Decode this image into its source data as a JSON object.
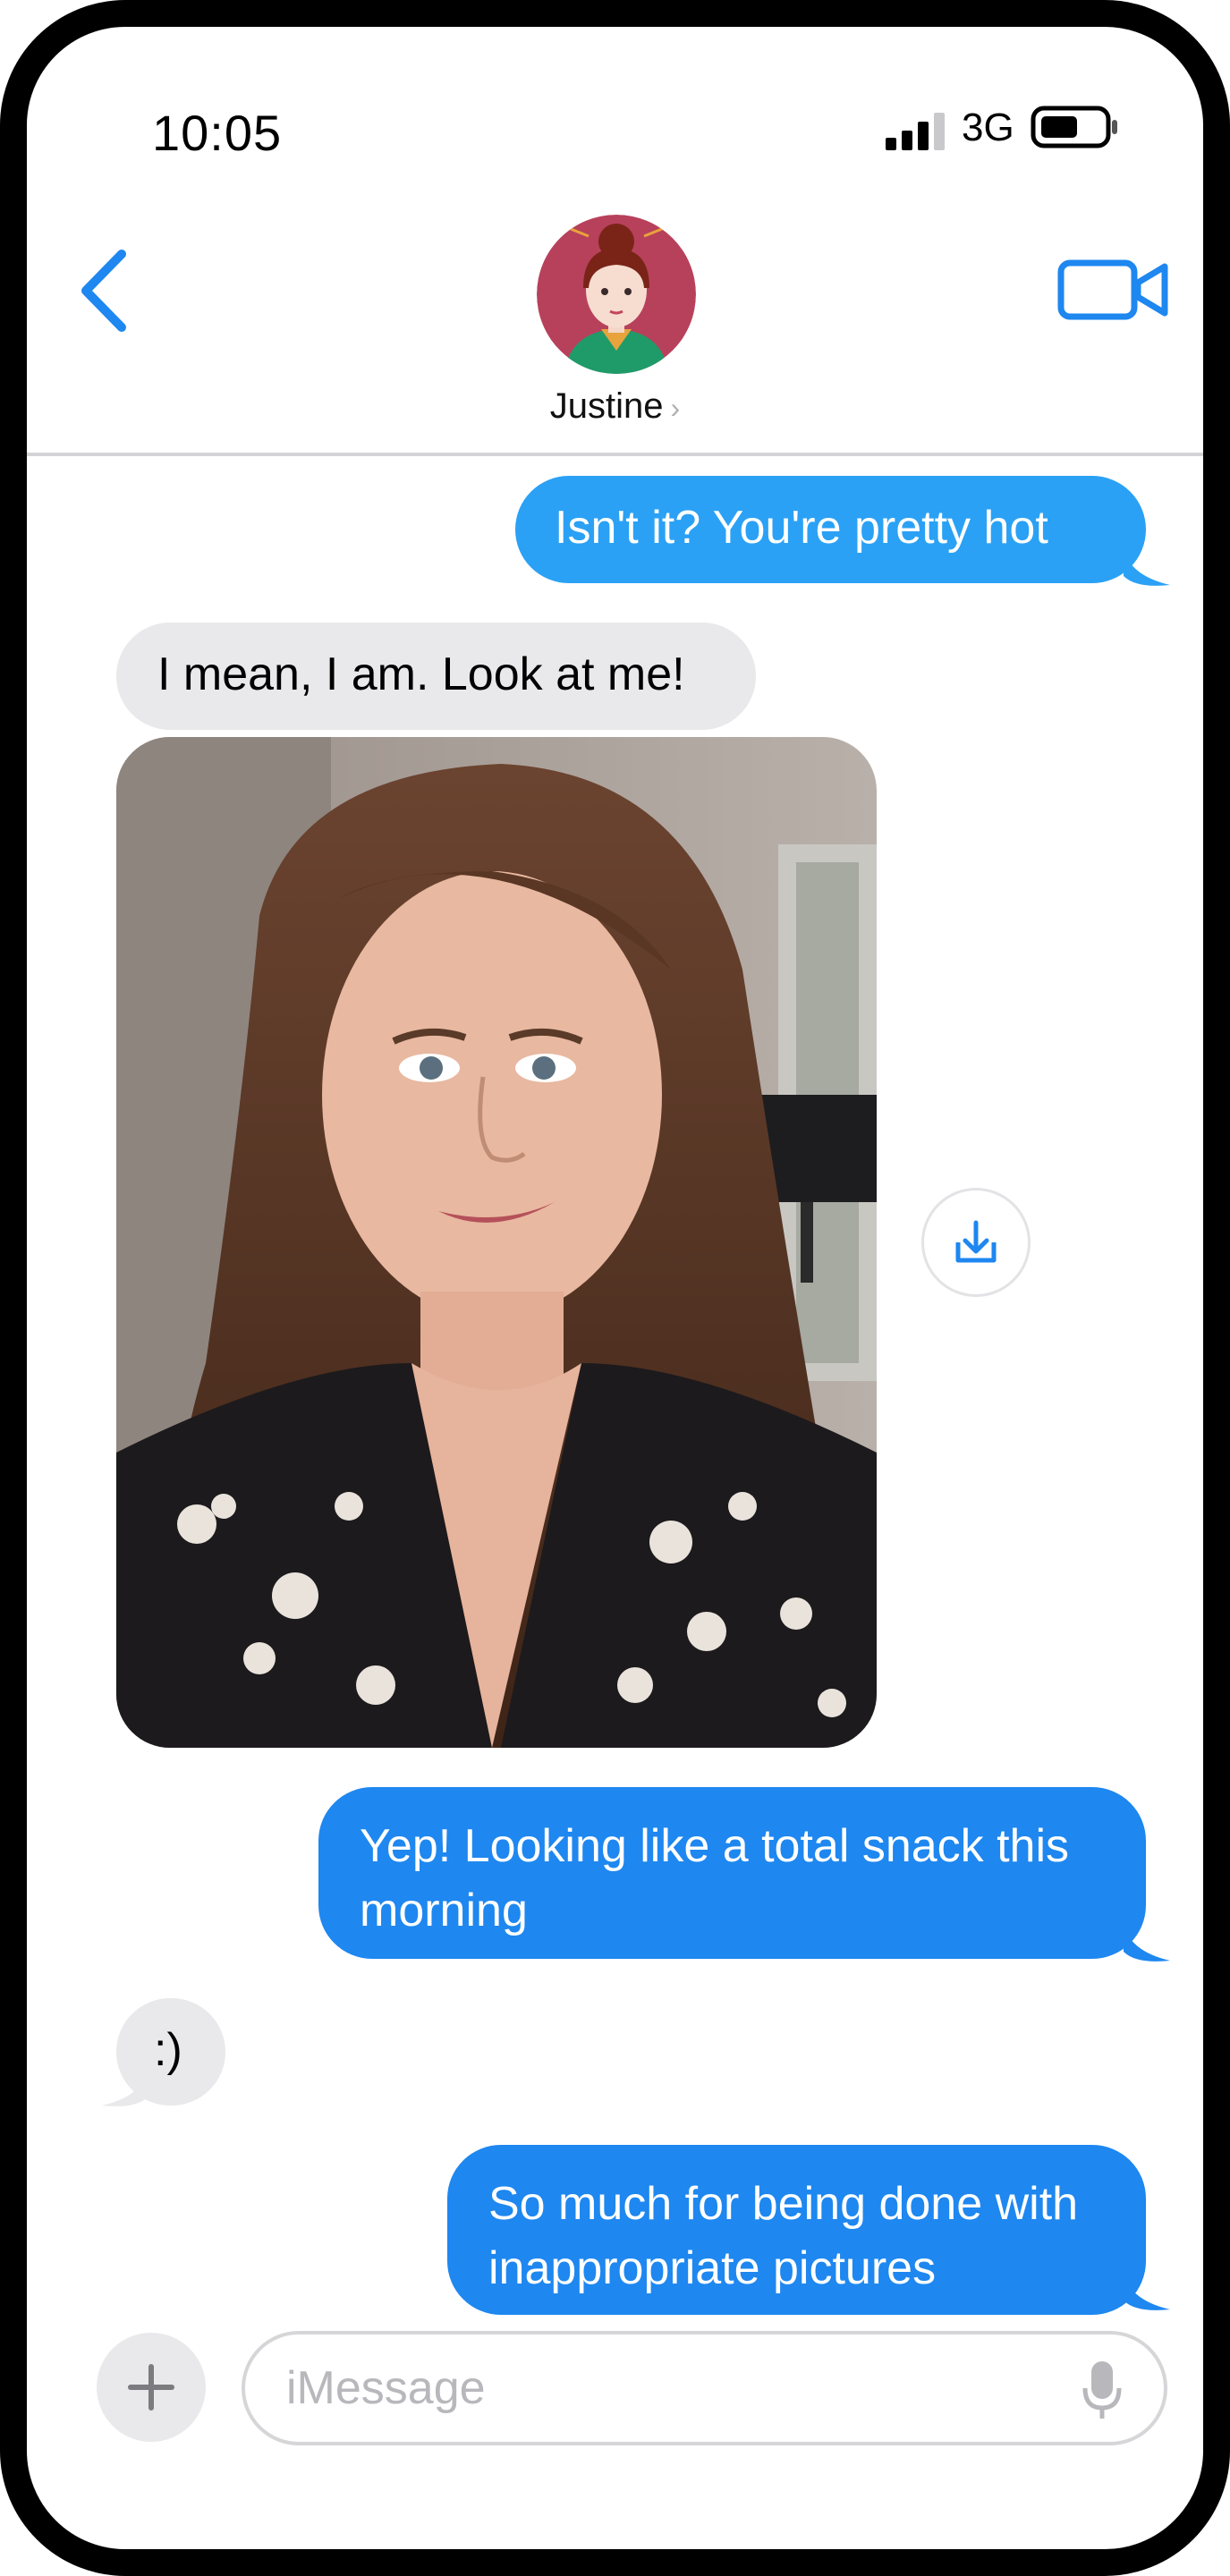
{
  "status_bar": {
    "time": "10:05",
    "network": "3G"
  },
  "header": {
    "contact_name": "Justine",
    "chevron": "›",
    "icons": {
      "back": "chevron-left-icon",
      "video": "video-camera-icon"
    }
  },
  "messages": [
    {
      "direction": "outgoing",
      "text": "Isn't it?  You're pretty hot"
    },
    {
      "direction": "incoming",
      "text": "I mean, I am.  Look at me!"
    },
    {
      "direction": "incoming",
      "type": "photo"
    },
    {
      "direction": "outgoing",
      "lines": [
        "Yep!  Looking like a total snack this",
        "morning"
      ]
    },
    {
      "direction": "incoming",
      "text": ":)"
    },
    {
      "direction": "outgoing",
      "lines": [
        "So much for being done with",
        "inappropriate pictures"
      ]
    }
  ],
  "composer": {
    "placeholder": "iMessage",
    "icons": {
      "add": "plus-icon",
      "mic": "microphone-icon",
      "save": "download-icon"
    }
  },
  "colors": {
    "outgoing_bubble": "#1e87f0",
    "outgoing_bubble_light": "#2aa1f5",
    "incoming_bubble": "#e9e9eb",
    "accent": "#1e87f0"
  }
}
